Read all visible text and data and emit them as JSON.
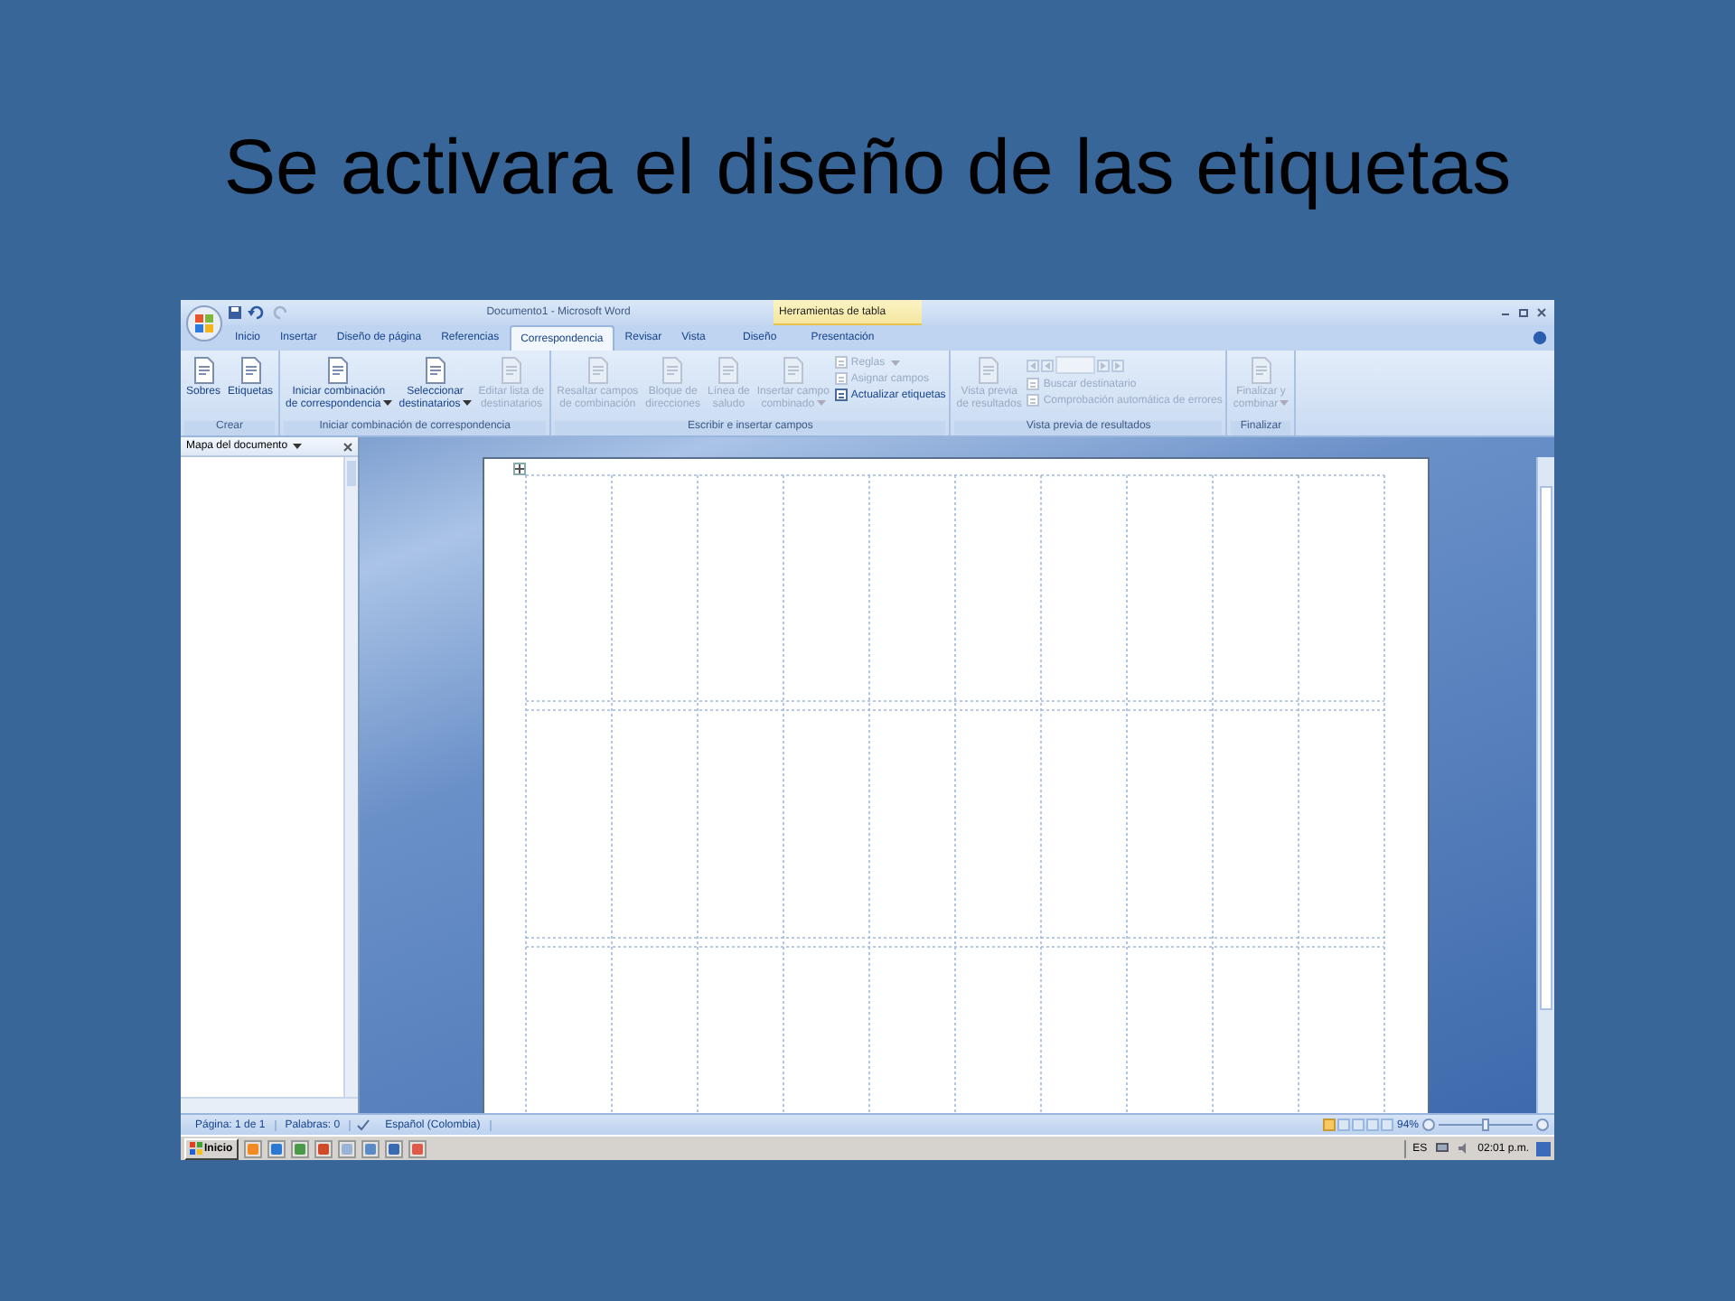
{
  "slide_title": "Se activara el diseño de las etiquetas",
  "window": {
    "title": "Documento1 - Microsoft Word",
    "context_group": "Herramientas de tabla"
  },
  "tabs": [
    {
      "label": "Inicio",
      "selected": false
    },
    {
      "label": "Insertar",
      "selected": false
    },
    {
      "label": "Diseño de página",
      "selected": false
    },
    {
      "label": "Referencias",
      "selected": false
    },
    {
      "label": "Correspondencia",
      "selected": true
    },
    {
      "label": "Revisar",
      "selected": false
    },
    {
      "label": "Vista",
      "selected": false
    }
  ],
  "context_tabs": [
    {
      "label": "Diseño",
      "selected": false
    },
    {
      "label": "Presentación",
      "selected": false
    }
  ],
  "ribbon": [
    {
      "label": "Crear",
      "items": [
        {
          "kind": "large",
          "label": "Sobres",
          "disabled": false
        },
        {
          "kind": "large",
          "label": "Etiquetas",
          "disabled": false
        }
      ]
    },
    {
      "label": "Iniciar combinación de correspondencia",
      "items": [
        {
          "kind": "large",
          "label": "Iniciar combinación\nde correspondencia",
          "dropdown": true,
          "disabled": false
        },
        {
          "kind": "large",
          "label": "Seleccionar\ndestinatarios",
          "dropdown": true,
          "disabled": false
        },
        {
          "kind": "large",
          "label": "Editar lista de\ndestinatarios",
          "disabled": true
        }
      ]
    },
    {
      "label": "Escribir e insertar campos",
      "items": [
        {
          "kind": "large",
          "label": "Resaltar campos\nde combinación",
          "disabled": true
        },
        {
          "kind": "large",
          "label": "Bloque de\ndirecciones",
          "disabled": true
        },
        {
          "kind": "large",
          "label": "Línea de\nsaludo",
          "disabled": true
        },
        {
          "kind": "large",
          "label": "Insertar campo\ncombinado",
          "dropdown": true,
          "disabled": true
        },
        {
          "kind": "stack",
          "items": [
            {
              "kind": "small",
              "label": "Reglas",
              "dropdown": true,
              "disabled": true
            },
            {
              "kind": "small",
              "label": "Asignar campos",
              "disabled": true
            },
            {
              "kind": "small",
              "label": "Actualizar etiquetas",
              "disabled": false
            }
          ]
        }
      ]
    },
    {
      "label": "Vista previa de resultados",
      "items": [
        {
          "kind": "large",
          "label": "Vista previa\nde resultados",
          "disabled": true
        },
        {
          "kind": "stack",
          "items": [
            {
              "kind": "nav",
              "disabled": true
            },
            {
              "kind": "small",
              "label": "Buscar destinatario",
              "disabled": true
            },
            {
              "kind": "small",
              "label": "Comprobación automática de errores",
              "disabled": true
            }
          ]
        }
      ]
    },
    {
      "label": "Finalizar",
      "items": [
        {
          "kind": "large",
          "label": "Finalizar y\ncombinar",
          "dropdown": true,
          "disabled": true
        }
      ]
    }
  ],
  "document_map": {
    "title": "Mapa del documento"
  },
  "status_bar": {
    "items": [
      "Página: 1 de 1",
      "Palabras: 0",
      "Español (Colombia)"
    ],
    "zoom": "94%",
    "zoom_slider": {
      "level": 0.5
    }
  },
  "taskbar": {
    "start": "Inicio",
    "language": "ES",
    "clock": "02:01 p.m."
  }
}
